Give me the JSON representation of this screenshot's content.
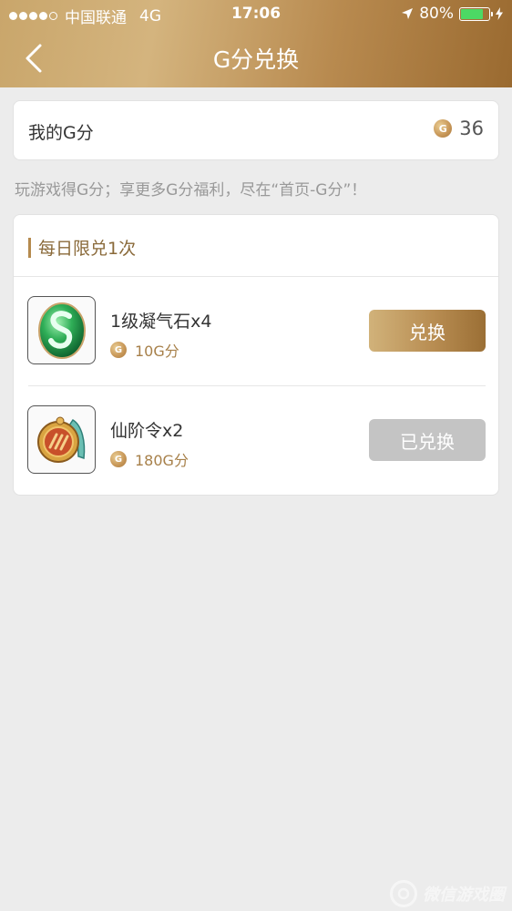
{
  "status_bar": {
    "carrier": "中国联通",
    "network": "4G",
    "time": "17:06",
    "battery": "80%",
    "battery_level": 0.8,
    "battery_color": "#4cd964"
  },
  "nav": {
    "title": "G分兑换",
    "back_icon": "chevron-left-icon"
  },
  "gscore": {
    "label": "我的G分",
    "coin_icon": "g-coin-icon",
    "coin_glyph": "G",
    "value": "36"
  },
  "hint": "玩游戏得G分；享更多G分福利，尽在“首页-G分”！",
  "daily": {
    "title": "每日限兑1次",
    "items": [
      {
        "name": "1级凝气石x4",
        "cost": "10G分",
        "button_label": "兑换",
        "state": "available",
        "icon": "green-gem-icon"
      },
      {
        "name": "仙阶令x2",
        "cost": "180G分",
        "button_label": "已兑换",
        "state": "redeemed",
        "icon": "medal-token-icon"
      }
    ]
  },
  "watermark": {
    "text": "微信游戏圈"
  },
  "colors": {
    "header_gold": "#c9a66b",
    "accent_brown": "#b58a4e",
    "button_active": "#b88d52",
    "button_disabled": "#c4c4c4",
    "background": "#ececec"
  }
}
